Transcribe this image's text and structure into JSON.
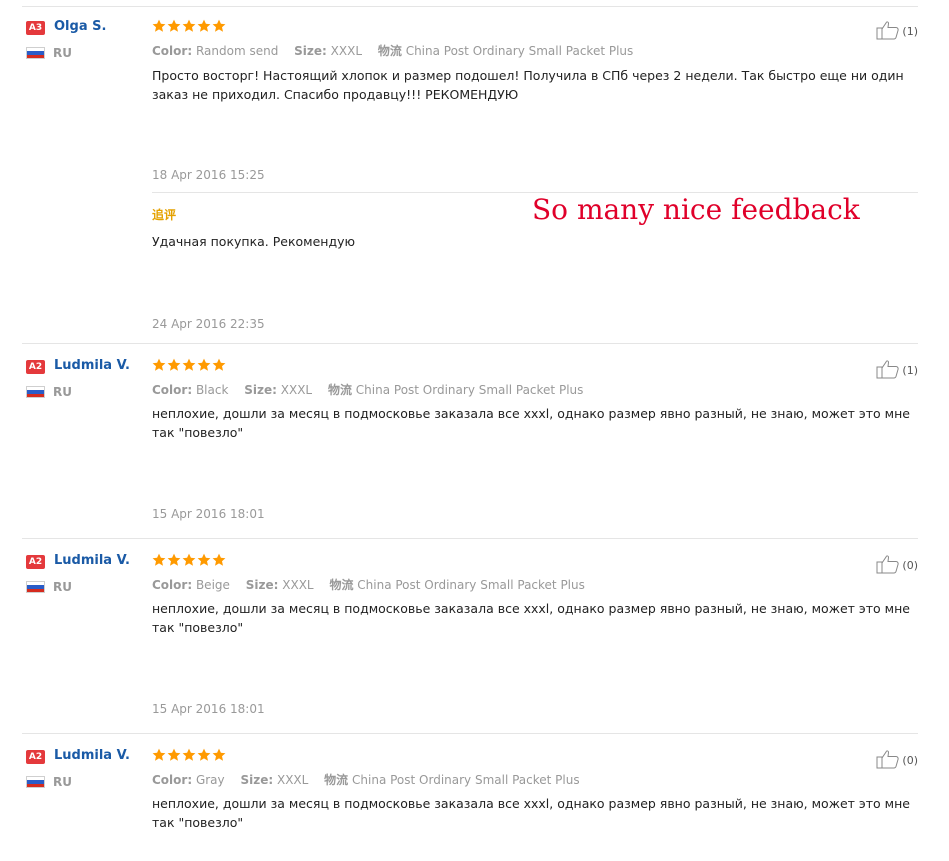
{
  "overlay_text": "So many nice feedback",
  "labels": {
    "color": "Color:",
    "size": "Size:",
    "shipping": "物流"
  },
  "reviews": [
    {
      "badge": "A3",
      "name": "Olga S.",
      "country": "RU",
      "rating": 5,
      "color": "Random send",
      "size": "XXXL",
      "shipping": "China Post Ordinary Small Packet Plus",
      "text": "Просто восторг! Настоящий хлопок и размер подошел! Получила в СПб через 2 недели. Так быстро еще ни один заказ не приходил. Спасибо продавцу!!! РЕКОМЕНДУЮ",
      "date": "18 Apr 2016 15:25",
      "helpful": "(1)",
      "appended": {
        "label": "追评",
        "text": "Удачная покупка. Рекомендую",
        "date": "24 Apr 2016 22:35"
      }
    },
    {
      "badge": "A2",
      "name": "Ludmila V.",
      "country": "RU",
      "rating": 5,
      "color": "Black",
      "size": "XXXL",
      "shipping": "China Post Ordinary Small Packet Plus",
      "text": "неплохие, дошли за месяц в подмосковье заказала все xxxl, однако размер явно разный, не знаю, может это мне так \"повезло\"",
      "date": "15 Apr 2016 18:01",
      "helpful": "(1)"
    },
    {
      "badge": "A2",
      "name": "Ludmila V.",
      "country": "RU",
      "rating": 5,
      "color": "Beige",
      "size": "XXXL",
      "shipping": "China Post Ordinary Small Packet Plus",
      "text": "неплохие, дошли за месяц в подмосковье заказала все xxxl, однако размер явно разный, не знаю, может это мне так \"повезло\"",
      "date": "15 Apr 2016 18:01",
      "helpful": "(0)"
    },
    {
      "badge": "A2",
      "name": "Ludmila V.",
      "country": "RU",
      "rating": 5,
      "color": "Gray",
      "size": "XXXL",
      "shipping": "China Post Ordinary Small Packet Plus",
      "text": "неплохие, дошли за месяц в подмосковье заказала все xxxl, однако размер явно разный, не знаю, может это мне так \"повезло\"",
      "helpful": "(0)"
    }
  ],
  "colors": {
    "badge": "#e4393c",
    "username": "#1a5aa6",
    "star": "#ff9a00",
    "append_label": "#e4a100",
    "overlay": "#e0002a"
  },
  "icons": {
    "helpful": "thumbs-up-icon",
    "rating": "star-icon",
    "flag": "russia-flag-icon"
  }
}
